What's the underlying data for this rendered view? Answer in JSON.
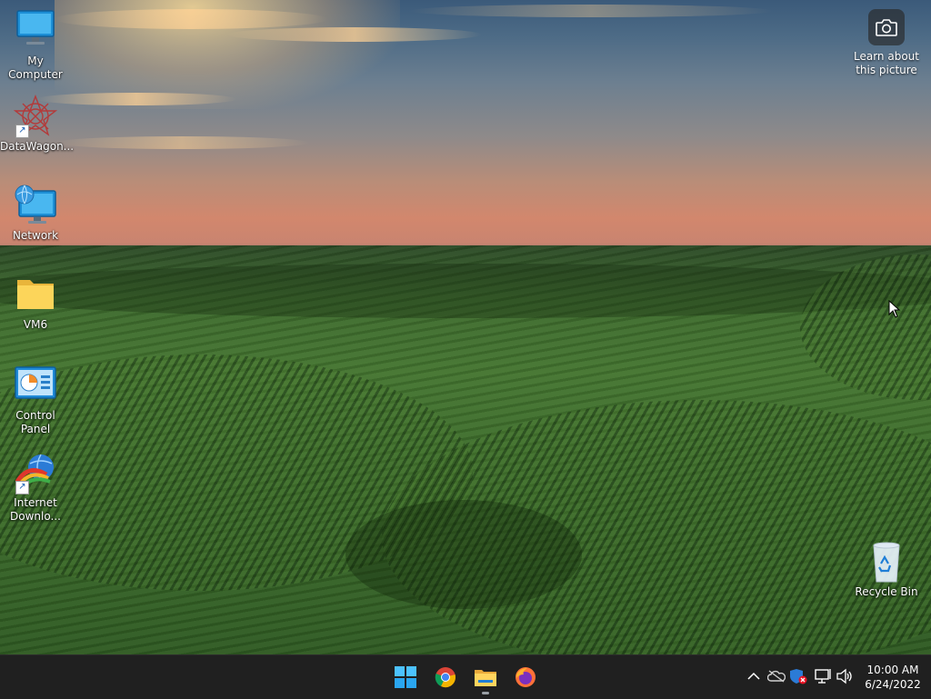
{
  "desktop": {
    "icons": [
      {
        "label": "My Computer",
        "icon": "monitor-icon",
        "shortcut": false
      },
      {
        "label": "DataWagon...",
        "icon": "datawagon-icon",
        "shortcut": true
      },
      {
        "label": "Network",
        "icon": "network-icon",
        "shortcut": false
      },
      {
        "label": "VM6",
        "icon": "folder-icon",
        "shortcut": false
      },
      {
        "label": "Control Panel",
        "icon": "control-panel-icon",
        "shortcut": false
      },
      {
        "label": "Internet Downlo...",
        "label_line1": "Internet",
        "label_line2": "Downlo...",
        "icon": "internet-download-manager-icon",
        "shortcut": true
      }
    ],
    "recycle_bin": {
      "label": "Recycle Bin",
      "icon": "recycle-bin-icon"
    },
    "spotlight": {
      "line1": "Learn about",
      "line2": "this picture",
      "icon": "camera-icon"
    }
  },
  "taskbar": {
    "apps": [
      {
        "name": "Start",
        "icon": "windows-start-icon"
      },
      {
        "name": "Google Chrome",
        "icon": "chrome-icon"
      },
      {
        "name": "File Explorer",
        "icon": "file-explorer-icon",
        "active": true
      },
      {
        "name": "Firefox",
        "icon": "firefox-icon"
      }
    ],
    "tray": [
      {
        "icon": "chevron-up-icon"
      },
      {
        "icon": "onedrive-offline-icon"
      },
      {
        "icon": "security-warning-icon"
      },
      {
        "icon": "network-status-icon"
      },
      {
        "icon": "volume-icon"
      }
    ],
    "time": "10:00 AM",
    "date": "6/24/2022"
  },
  "colors": {
    "taskbar_bg": "#202020",
    "accent_blue": "#0078d4"
  }
}
